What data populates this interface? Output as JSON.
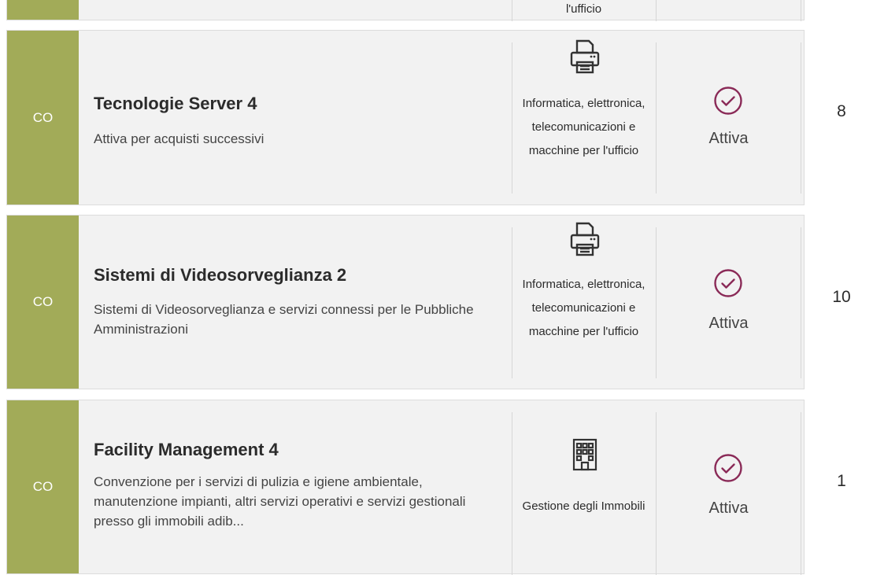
{
  "items": [
    {
      "tag": "",
      "category": "l'ufficio"
    },
    {
      "tag": "CO",
      "title": "Tecnologie Server 4",
      "description": "Attiva per acquisti successivi",
      "category_icon": "printer-icon",
      "category": "Informatica, elettronica, telecomunicazioni e macchine per l'ufficio",
      "status_icon": "check-circle-icon",
      "status": "Attiva",
      "count": "8"
    },
    {
      "tag": "CO",
      "title": "Sistemi di Videosorveglianza 2",
      "description": "Sistemi di Videosorveglianza e servizi connessi per le Pubbliche Amministrazioni",
      "category_icon": "printer-icon",
      "category": "Informatica, elettronica, telecomunicazioni e macchine per l'ufficio",
      "status_icon": "check-circle-icon",
      "status": "Attiva",
      "count": "10"
    },
    {
      "tag": "CO",
      "title": "Facility Management 4",
      "description": "Convenzione per i servizi di pulizia e igiene ambientale, manutenzione impianti, altri servizi operativi e servizi gestionali presso gli immobili adib...",
      "category_icon": "building-icon",
      "category": "Gestione degli Immobili",
      "status_icon": "check-circle-icon",
      "status": "Attiva",
      "count": "1"
    }
  ],
  "colors": {
    "tag_background": "#a2ab58",
    "status_icon": "#8a2a57",
    "card_background": "#f2f2f2"
  }
}
